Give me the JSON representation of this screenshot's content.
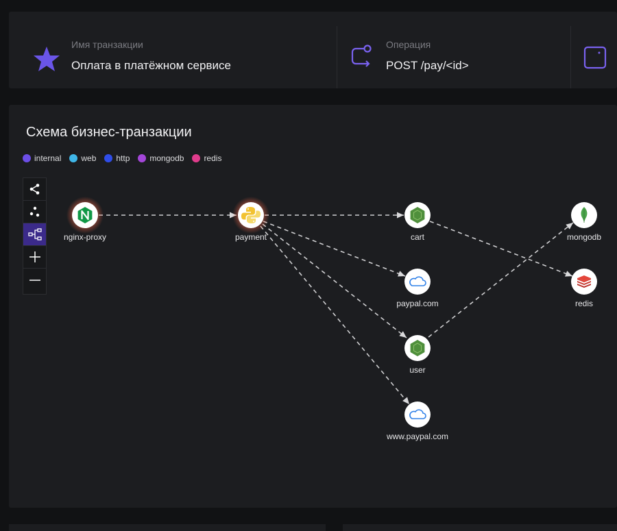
{
  "header": {
    "transaction": {
      "label": "Имя транзакции",
      "value": "Оплата в платёжном сервисе",
      "icon": "star-icon"
    },
    "operation": {
      "label": "Операция",
      "value": "POST /pay/<id>",
      "icon": "route-icon"
    },
    "third": {
      "icon": "square-icon"
    }
  },
  "diagram": {
    "title": "Схема бизнес-транзакции",
    "legend": [
      {
        "label": "internal",
        "color": "#6c4ee6"
      },
      {
        "label": "web",
        "color": "#3fb6e8"
      },
      {
        "label": "http",
        "color": "#2f4de8"
      },
      {
        "label": "mongodb",
        "color": "#a346d8"
      },
      {
        "label": "redis",
        "color": "#e03c8c"
      }
    ],
    "toolbar": [
      "share-icon",
      "scatter-icon",
      "hierarchy-icon",
      "zoom-in-icon",
      "zoom-out-icon"
    ],
    "active_tool": "hierarchy-icon",
    "nodes": [
      {
        "id": "nginx-proxy",
        "label": "nginx-proxy",
        "icon": "nginx-icon",
        "highlighted": true
      },
      {
        "id": "payment",
        "label": "payment",
        "icon": "python-icon",
        "highlighted": true
      },
      {
        "id": "cart",
        "label": "cart",
        "icon": "nodejs-icon"
      },
      {
        "id": "paypal",
        "label": "paypal.com",
        "icon": "cloud-icon"
      },
      {
        "id": "user",
        "label": "user",
        "icon": "nodejs-icon"
      },
      {
        "id": "wwwpaypal",
        "label": "www.paypal.com",
        "icon": "cloud-icon"
      },
      {
        "id": "mongodb",
        "label": "mongodb",
        "icon": "mongodb-icon"
      },
      {
        "id": "redis",
        "label": "redis",
        "icon": "redis-icon"
      }
    ],
    "edges": [
      [
        "nginx-proxy",
        "payment"
      ],
      [
        "payment",
        "cart"
      ],
      [
        "payment",
        "paypal"
      ],
      [
        "payment",
        "user"
      ],
      [
        "payment",
        "wwwpaypal"
      ],
      [
        "cart",
        "redis"
      ],
      [
        "user",
        "mongodb"
      ]
    ]
  }
}
